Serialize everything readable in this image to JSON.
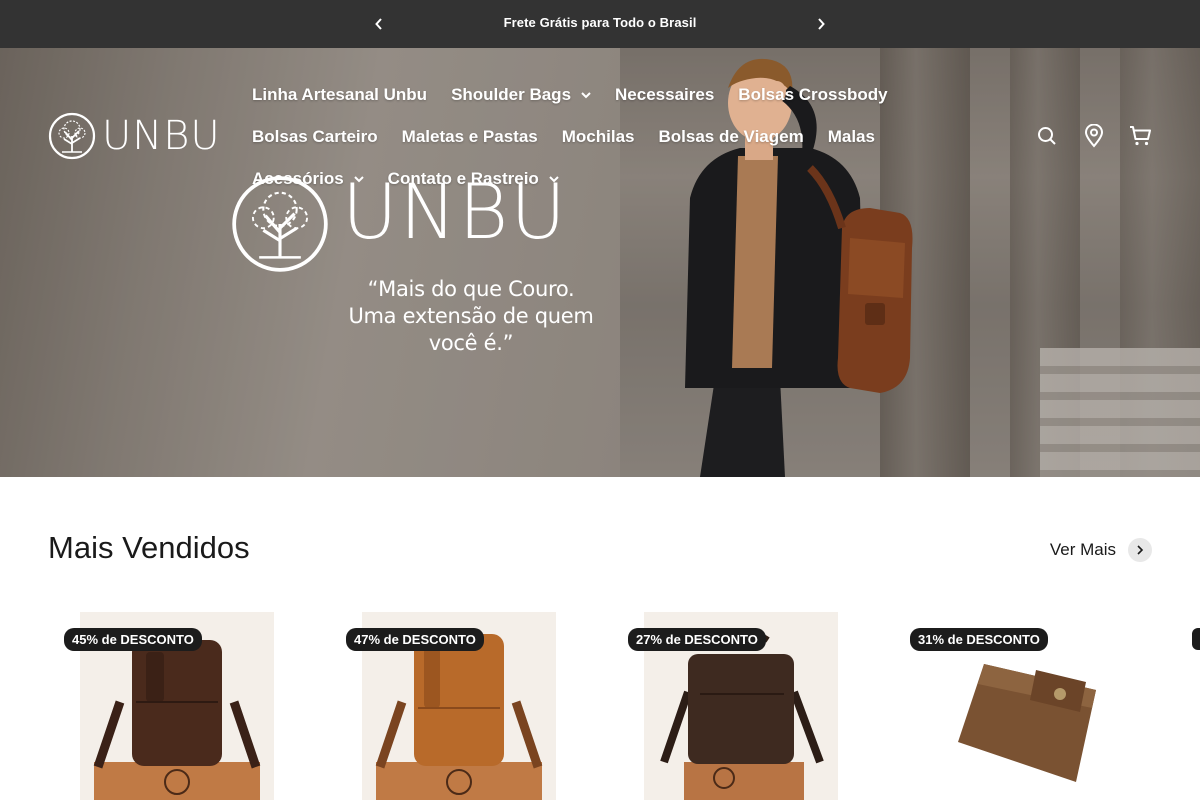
{
  "announcement": {
    "message": "Frete Grátis para Todo o Brasil",
    "prev_icon": "chevron-left-icon",
    "next_icon": "chevron-right-icon"
  },
  "header": {
    "logo_text": "UNBU",
    "nav": [
      {
        "label": "Linha Artesanal Unbu",
        "dropdown": false
      },
      {
        "label": "Shoulder Bags",
        "dropdown": true
      },
      {
        "label": "Necessaires",
        "dropdown": false
      },
      {
        "label": "Bolsas Crossbody",
        "dropdown": false
      },
      {
        "label": "Bolsas Carteiro",
        "dropdown": false
      },
      {
        "label": "Maletas e Pastas",
        "dropdown": false
      },
      {
        "label": "Mochilas",
        "dropdown": false
      },
      {
        "label": "Bolsas de Viagem",
        "dropdown": false
      },
      {
        "label": "Malas",
        "dropdown": false
      },
      {
        "label": "Acessórios",
        "dropdown": true
      },
      {
        "label": "Contato e Rastreio",
        "dropdown": true
      }
    ],
    "icons": [
      "search-icon",
      "location-pin-icon",
      "cart-icon"
    ]
  },
  "hero": {
    "brand": "UNBU",
    "tagline_lines": [
      "“Mais do que Couro.",
      "Uma extensão de quem",
      "você é.”"
    ]
  },
  "best_sellers": {
    "title": "Mais Vendidos",
    "see_more": "Ver Mais",
    "products": [
      {
        "badge": "45% de DESCONTO",
        "color": "#4a2a1c"
      },
      {
        "badge": "47% de DESCONTO",
        "color": "#b86a2a"
      },
      {
        "badge": "27% de DESCONTO",
        "color": "#3e2a20"
      },
      {
        "badge": "31% de DESCONTO",
        "color": "#7a5232"
      }
    ]
  },
  "colors": {
    "announcement_bg": "#333333",
    "badge_bg": "#1c1c1c",
    "text": "#1a1a1a"
  }
}
